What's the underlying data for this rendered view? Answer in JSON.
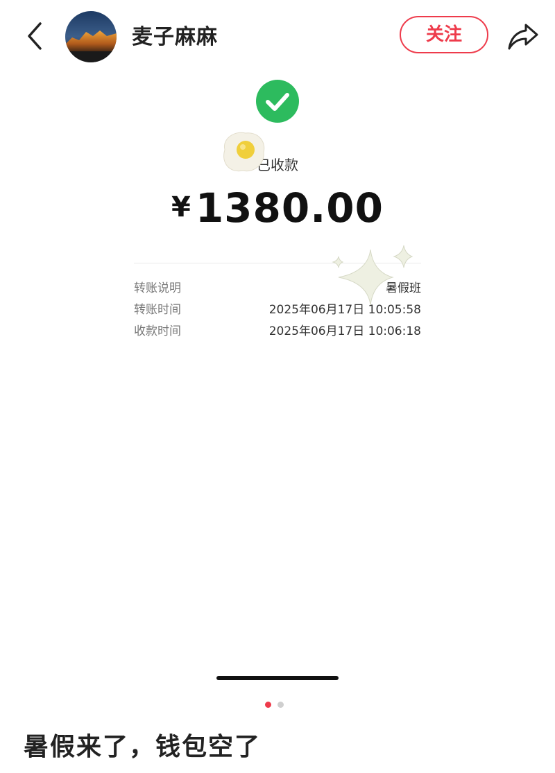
{
  "header": {
    "author_name": "麦子麻麻",
    "follow_label": "关注"
  },
  "receipt": {
    "status": "已收款",
    "currency": "¥",
    "amount": "1380.00",
    "rows": [
      {
        "label": "转账说明",
        "value": "暑假班"
      },
      {
        "label": "转账时间",
        "value": "2025年06月17日 10:05:58"
      },
      {
        "label": "收款时间",
        "value": "2025年06月17日 10:06:18"
      }
    ]
  },
  "pagination": {
    "current": 1,
    "total": 2
  },
  "post": {
    "caption": "暑假来了，钱包空了"
  },
  "colors": {
    "accent": "#ee3b4b",
    "success": "#2dbb5e"
  },
  "icons": [
    "back-arrow-icon",
    "share-icon",
    "success-check-icon",
    "egg-sticker",
    "sparkle-sticker"
  ]
}
